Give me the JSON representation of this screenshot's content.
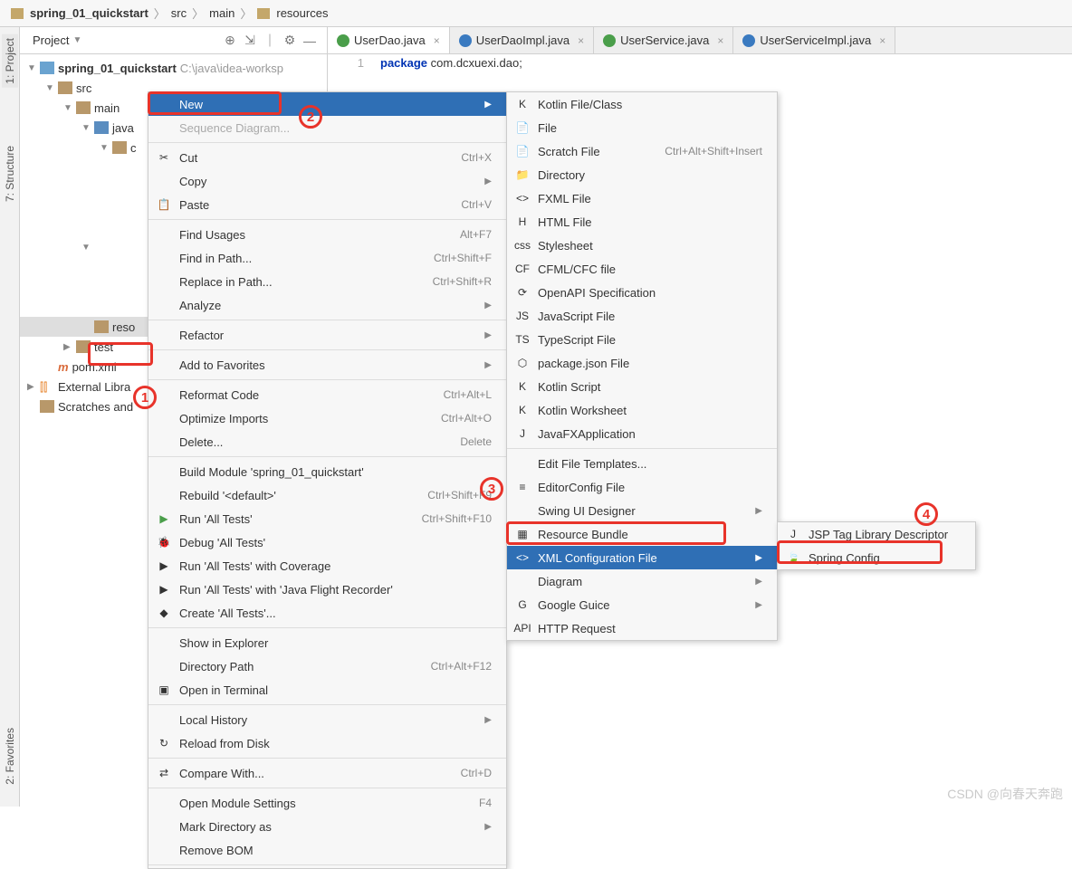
{
  "breadcrumb": {
    "project": "spring_01_quickstart",
    "src": "src",
    "main": "main",
    "resources": "resources"
  },
  "project_panel": {
    "title": "Project",
    "tree": {
      "root": "spring_01_quickstart",
      "root_path": "C:\\java\\idea-worksp",
      "src": "src",
      "main": "main",
      "java": "java",
      "c": "c",
      "resources": "reso",
      "test": "test",
      "pom": "pom.xml",
      "external": "External Libra",
      "scratches": "Scratches and"
    }
  },
  "left_tabs": {
    "project": "1: Project",
    "structure": "7: Structure",
    "favorites": "2: Favorites"
  },
  "tabs": [
    {
      "label": "UserDao.java",
      "type": "i",
      "active": true
    },
    {
      "label": "UserDaoImpl.java",
      "type": "c",
      "active": false
    },
    {
      "label": "UserService.java",
      "type": "i",
      "active": false
    },
    {
      "label": "UserServiceImpl.java",
      "type": "c",
      "active": false
    }
  ],
  "editor": {
    "line": "1",
    "kw": "package",
    "pkg": " com.dcxuexi.dao;"
  },
  "context_menu": [
    {
      "text": "New",
      "sub": true,
      "hl": true
    },
    {
      "text": "Sequence Diagram...",
      "disabled": true
    },
    {
      "sep": true
    },
    {
      "text": "Cut",
      "icon": "✂",
      "sc": "Ctrl+X"
    },
    {
      "text": "Copy",
      "sub": true
    },
    {
      "text": "Paste",
      "icon": "📋",
      "sc": "Ctrl+V"
    },
    {
      "sep": true
    },
    {
      "text": "Find Usages",
      "sc": "Alt+F7"
    },
    {
      "text": "Find in Path...",
      "sc": "Ctrl+Shift+F"
    },
    {
      "text": "Replace in Path...",
      "sc": "Ctrl+Shift+R"
    },
    {
      "text": "Analyze",
      "sub": true
    },
    {
      "sep": true
    },
    {
      "text": "Refactor",
      "sub": true
    },
    {
      "sep": true
    },
    {
      "text": "Add to Favorites",
      "sub": true
    },
    {
      "sep": true
    },
    {
      "text": "Reformat Code",
      "sc": "Ctrl+Alt+L"
    },
    {
      "text": "Optimize Imports",
      "sc": "Ctrl+Alt+O"
    },
    {
      "text": "Delete...",
      "sc": "Delete"
    },
    {
      "sep": true
    },
    {
      "text": "Build Module 'spring_01_quickstart'"
    },
    {
      "text": "Rebuild '<default>'",
      "sc": "Ctrl+Shift+F9"
    },
    {
      "text": "Run 'All Tests'",
      "icon": "▶",
      "iconColor": "#4a9e4a",
      "sc": "Ctrl+Shift+F10"
    },
    {
      "text": "Debug 'All Tests'",
      "icon": "🐞"
    },
    {
      "text": "Run 'All Tests' with Coverage",
      "icon": "▶"
    },
    {
      "text": "Run 'All Tests' with 'Java Flight Recorder'",
      "icon": "▶"
    },
    {
      "text": "Create 'All Tests'...",
      "icon": "◆"
    },
    {
      "sep": true
    },
    {
      "text": "Show in Explorer"
    },
    {
      "text": "Directory Path",
      "sc": "Ctrl+Alt+F12"
    },
    {
      "text": "Open in Terminal",
      "icon": "▣"
    },
    {
      "sep": true
    },
    {
      "text": "Local History",
      "sub": true
    },
    {
      "text": "Reload from Disk",
      "icon": "↻"
    },
    {
      "sep": true
    },
    {
      "text": "Compare With...",
      "icon": "⇄",
      "sc": "Ctrl+D"
    },
    {
      "sep": true
    },
    {
      "text": "Open Module Settings",
      "sc": "F4"
    },
    {
      "text": "Mark Directory as",
      "sub": true
    },
    {
      "text": "Remove BOM"
    },
    {
      "sep": true
    }
  ],
  "new_submenu": [
    {
      "text": "Kotlin File/Class",
      "icon": "K"
    },
    {
      "text": "File",
      "icon": "📄"
    },
    {
      "text": "Scratch File",
      "icon": "📄",
      "sc": "Ctrl+Alt+Shift+Insert"
    },
    {
      "text": "Directory",
      "icon": "📁"
    },
    {
      "text": "FXML File",
      "icon": "<>"
    },
    {
      "text": "HTML File",
      "icon": "H"
    },
    {
      "text": "Stylesheet",
      "icon": "css"
    },
    {
      "text": "CFML/CFC file",
      "icon": "CF"
    },
    {
      "text": "OpenAPI Specification",
      "icon": "⟳"
    },
    {
      "text": "JavaScript File",
      "icon": "JS"
    },
    {
      "text": "TypeScript File",
      "icon": "TS"
    },
    {
      "text": "package.json File",
      "icon": "⬡"
    },
    {
      "text": "Kotlin Script",
      "icon": "K"
    },
    {
      "text": "Kotlin Worksheet",
      "icon": "K"
    },
    {
      "text": "JavaFXApplication",
      "icon": "J"
    },
    {
      "sep": true
    },
    {
      "text": "Edit File Templates..."
    },
    {
      "text": "EditorConfig File",
      "icon": "≡"
    },
    {
      "text": "Swing UI Designer",
      "sub": true
    },
    {
      "text": "Resource Bundle",
      "icon": "▦"
    },
    {
      "text": "XML Configuration File",
      "icon": "<>",
      "sub": true,
      "hl": true
    },
    {
      "text": "Diagram",
      "sub": true
    },
    {
      "text": "Google Guice",
      "icon": "G",
      "sub": true
    },
    {
      "text": "HTTP Request",
      "icon": "API"
    }
  ],
  "xml_submenu": [
    {
      "text": "JSP Tag Library Descriptor",
      "icon": "J"
    },
    {
      "text": "Spring Config",
      "icon": "🍃"
    }
  ],
  "annotations": {
    "n1": "1",
    "n2": "2",
    "n3": "3",
    "n4": "4"
  },
  "watermark": "CSDN @向春天奔跑"
}
